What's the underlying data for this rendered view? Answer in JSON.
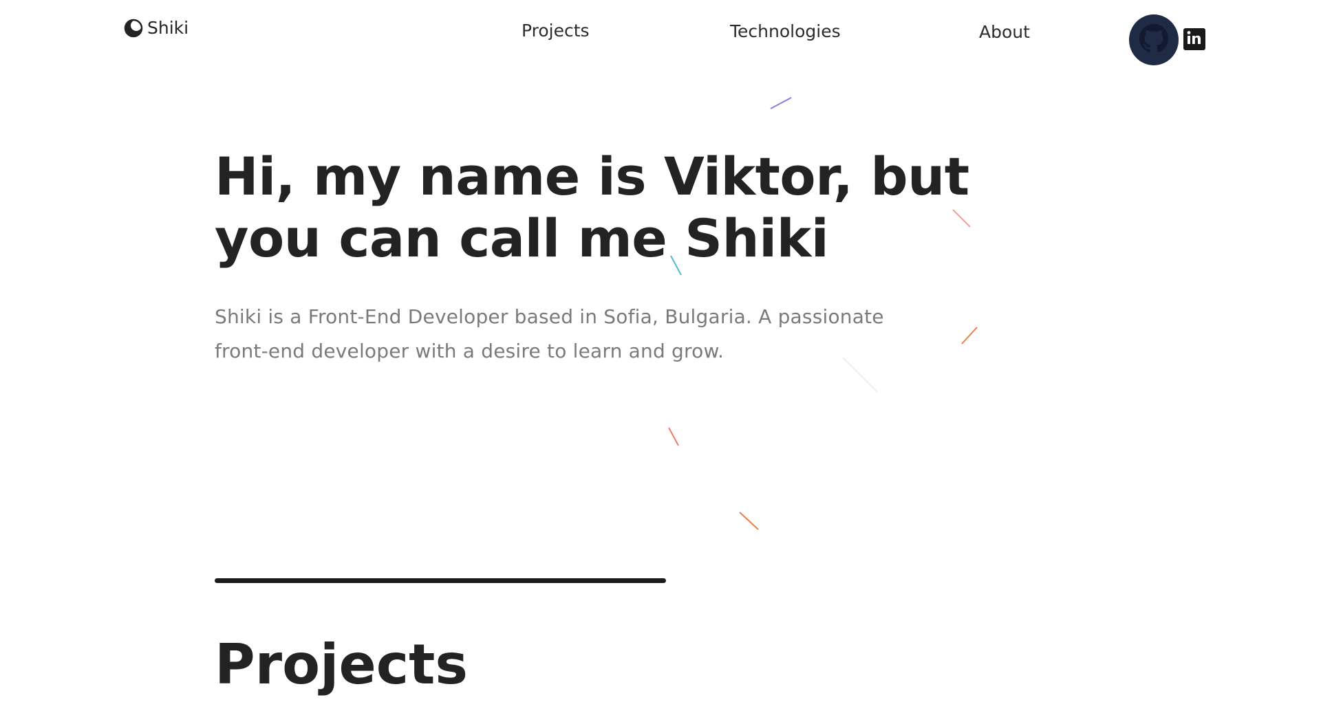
{
  "header": {
    "logo_text": "Shiki",
    "nav": {
      "projects": "Projects",
      "technologies": "Technologies",
      "about": "About"
    },
    "social": {
      "github_icon": "github-icon",
      "linkedin_icon": "linkedin-icon",
      "linkedin_glyph": "in"
    }
  },
  "hero": {
    "heading": "Hi, my name is Viktor, but you can call me Shiki",
    "description": "Shiki is a Front-End Developer based in Sofia, Bulgaria. A passionate front-end developer with a desire to learn and grow."
  },
  "projects": {
    "heading": "Projects"
  },
  "colors": {
    "text_dark": "#232323",
    "text_muted": "#7a7a7a",
    "github_bg": "#1f2a44",
    "streak_colors": [
      "#8e7be0",
      "#f08a6a",
      "#4fb8d8",
      "#f07a4a"
    ]
  }
}
